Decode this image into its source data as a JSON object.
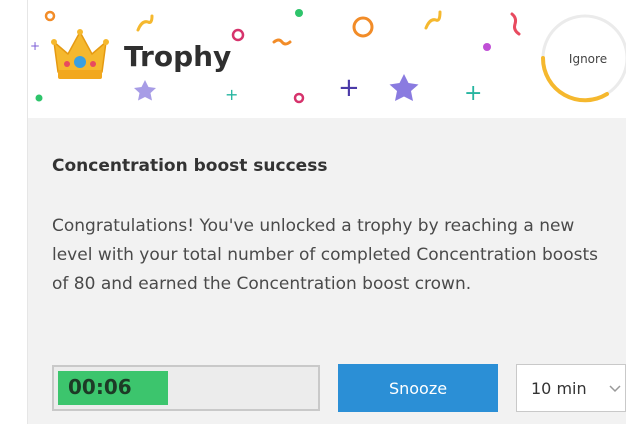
{
  "header": {
    "title": "Trophy",
    "ignore_label": "Ignore"
  },
  "content": {
    "subtitle": "Concentration boost success",
    "message": "Congratulations! You've unlocked a trophy by reaching a new level with your total number of completed Concentration boosts of 80 and earned the Concentration boost crown."
  },
  "controls": {
    "timer": {
      "value": "00:06",
      "progress": 0.43
    },
    "snooze_label": "Snooze",
    "snooze_duration": "10 min"
  },
  "colors": {
    "accent": "#2b8fd6",
    "timer_fill": "#3cc56d",
    "ring": "#f5b82e",
    "crown": "#f5b82e",
    "background": "#f2f2f2"
  },
  "icons": [
    "crown-icon",
    "confetti",
    "ignore-timer-ring",
    "chevron-down-icon"
  ]
}
